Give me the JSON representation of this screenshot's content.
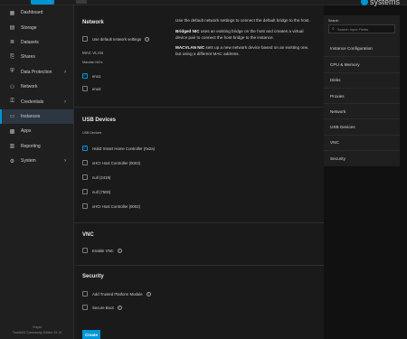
{
  "header": {
    "brand": "systems"
  },
  "sidebar": {
    "items": [
      {
        "label": "Dashboard",
        "icon": "dashboard-icon",
        "glyph": "▦"
      },
      {
        "label": "Storage",
        "icon": "storage-icon",
        "glyph": "▤"
      },
      {
        "label": "Datasets",
        "icon": "datasets-icon",
        "glyph": "≣"
      },
      {
        "label": "Shares",
        "icon": "shares-icon",
        "glyph": "⎘"
      },
      {
        "label": "Data Protection",
        "icon": "data-protection-icon",
        "glyph": "⛨"
      },
      {
        "label": "Network",
        "icon": "network-icon",
        "glyph": "⚇"
      },
      {
        "label": "Credentials",
        "icon": "credentials-icon",
        "glyph": "⚿"
      },
      {
        "label": "Instances",
        "icon": "instances-icon",
        "glyph": "▭"
      },
      {
        "label": "Apps",
        "icon": "apps-icon",
        "glyph": "▩"
      },
      {
        "label": "Reporting",
        "icon": "reporting-icon",
        "glyph": "▥"
      },
      {
        "label": "System",
        "icon": "system-icon",
        "glyph": "⚙"
      }
    ],
    "footer_line1": "iXsyst",
    "footer_line2": "TrueNAS Community Edition 25.10"
  },
  "network": {
    "title": "Network",
    "use_default_label": "Use default network settings",
    "mac_vlan_label": "MAC VLAN",
    "macvlan_nics_label": "Macvlan NICs",
    "nics": [
      {
        "label": "eno1",
        "checked": true
      },
      {
        "label": "eno2",
        "checked": false
      }
    ],
    "desc_intro": "Use the default network settings to connect the default bridge to the host.",
    "bridged_title": "Bridged NIC",
    "bridged_text": " uses an existing bridge on the host and creates a virtual device pair to connect the host bridge to the instance.",
    "macvlan_title": "MACVLAN NIC",
    "macvlan_text": " sets up a new network device based on an existing one, but using a different MAC address."
  },
  "usb": {
    "title": "USB Devices",
    "sub_label": "USB Devices",
    "devices": [
      {
        "label": "HubZ Smart Home Controller (0x2a)",
        "checked": true
      },
      {
        "label": "xHCI Host Controller (0003)",
        "checked": false
      },
      {
        "label": "null (2419)",
        "checked": false
      },
      {
        "label": "null (7500)",
        "checked": false
      },
      {
        "label": "xHCI Host Controller (0002)",
        "checked": false
      }
    ]
  },
  "vnc": {
    "title": "VNC",
    "enable_label": "Enable VNC"
  },
  "security": {
    "title": "Security",
    "tpm_label": "Add Trusted Platform Module",
    "secure_boot_label": "Secure Boot"
  },
  "actions": {
    "create_label": "Create"
  },
  "right_panel": {
    "search_label": "Search",
    "search_placeholder": "Search Input Fields",
    "items": [
      "Instance Configuration",
      "CPU & Memory",
      "Disks",
      "Proxies",
      "Network",
      "USB Devices",
      "VNC",
      "Security"
    ]
  },
  "colors": {
    "accent": "#0095d5",
    "background": "#1a1a1a",
    "sidebar": "#1f1f1f"
  }
}
